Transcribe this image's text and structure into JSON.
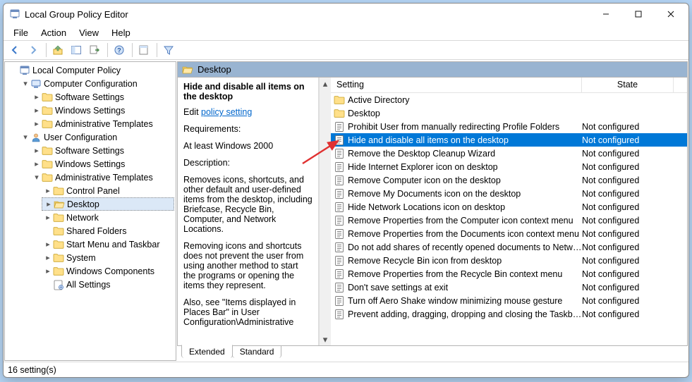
{
  "window": {
    "title": "Local Group Policy Editor"
  },
  "menubar": [
    "File",
    "Action",
    "View",
    "Help"
  ],
  "tree": {
    "root": "Local Computer Policy",
    "computer_cfg": "Computer Configuration",
    "cc_soft": "Software Settings",
    "cc_win": "Windows Settings",
    "cc_admin": "Administrative Templates",
    "user_cfg": "User Configuration",
    "uc_soft": "Software Settings",
    "uc_win": "Windows Settings",
    "uc_admin": "Administrative Templates",
    "at_controlpanel": "Control Panel",
    "at_desktop": "Desktop",
    "at_network": "Network",
    "at_sharedfolders": "Shared Folders",
    "at_startmenu": "Start Menu and Taskbar",
    "at_system": "System",
    "at_wincomp": "Windows Components",
    "at_allsettings": "All Settings"
  },
  "pane": {
    "header": "Desktop",
    "setting_header": "Setting",
    "state_header": "State",
    "tab_extended": "Extended",
    "tab_standard": "Standard"
  },
  "desc": {
    "title": "Hide and disable all items on the desktop",
    "edit_prefix": "Edit ",
    "edit_link": "policy setting ",
    "req_label": "Requirements:",
    "req_value": "At least Windows 2000",
    "desc_label": "Description:",
    "p1": "Removes icons, shortcuts, and other default and user-defined items from the desktop, including Briefcase, Recycle Bin, Computer, and Network Locations.",
    "p2": "Removing icons and shortcuts does not prevent the user from using another method to start the programs or opening the items they represent.",
    "p3": "Also, see \"Items displayed in Places Bar\" in User Configuration\\Administrative"
  },
  "settings": [
    {
      "type": "folder",
      "name": "Active Directory"
    },
    {
      "type": "folder",
      "name": "Desktop"
    },
    {
      "type": "policy",
      "name": "Prohibit User from manually redirecting Profile Folders",
      "state": "Not configured"
    },
    {
      "type": "policy",
      "name": "Hide and disable all items on the desktop",
      "state": "Not configured",
      "selected": true
    },
    {
      "type": "policy",
      "name": "Remove the Desktop Cleanup Wizard",
      "state": "Not configured"
    },
    {
      "type": "policy",
      "name": "Hide Internet Explorer icon on desktop",
      "state": "Not configured"
    },
    {
      "type": "policy",
      "name": "Remove Computer icon on the desktop",
      "state": "Not configured"
    },
    {
      "type": "policy",
      "name": "Remove My Documents icon on the desktop",
      "state": "Not configured"
    },
    {
      "type": "policy",
      "name": "Hide Network Locations icon on desktop",
      "state": "Not configured"
    },
    {
      "type": "policy",
      "name": "Remove Properties from the Computer icon context menu",
      "state": "Not configured"
    },
    {
      "type": "policy",
      "name": "Remove Properties from the Documents icon context menu",
      "state": "Not configured"
    },
    {
      "type": "policy",
      "name": "Do not add shares of recently opened documents to Networ...",
      "state": "Not configured"
    },
    {
      "type": "policy",
      "name": "Remove Recycle Bin icon from desktop",
      "state": "Not configured"
    },
    {
      "type": "policy",
      "name": "Remove Properties from the Recycle Bin context menu",
      "state": "Not configured"
    },
    {
      "type": "policy",
      "name": "Don't save settings at exit",
      "state": "Not configured"
    },
    {
      "type": "policy",
      "name": "Turn off Aero Shake window minimizing mouse gesture",
      "state": "Not configured"
    },
    {
      "type": "policy",
      "name": "Prevent adding, dragging, dropping and closing the Taskbar...",
      "state": "Not configured"
    }
  ],
  "status": "16 setting(s)"
}
